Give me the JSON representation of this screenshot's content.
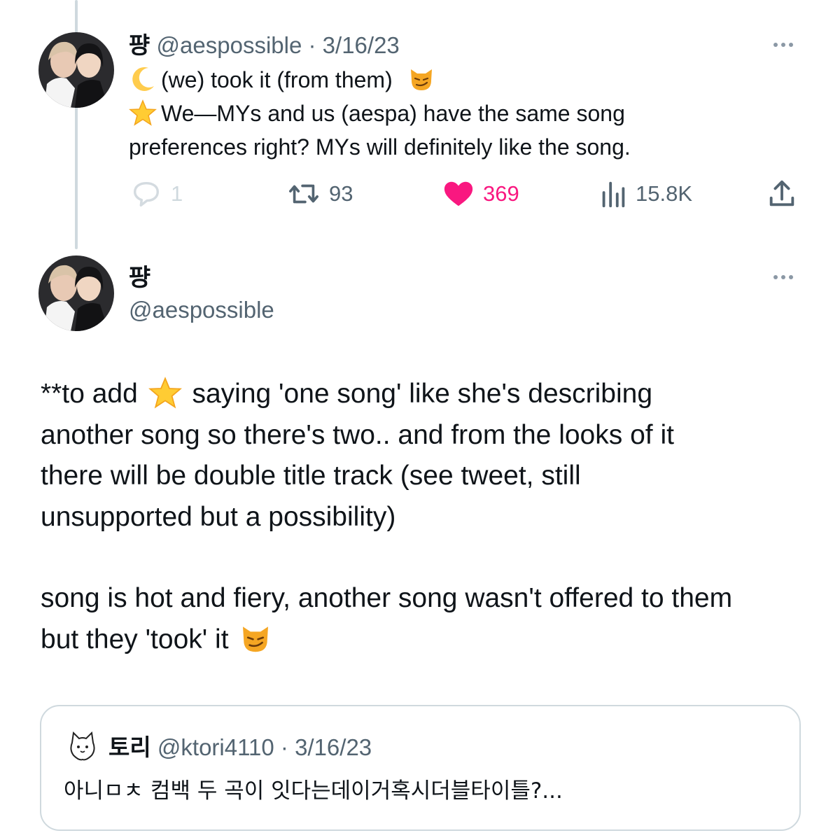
{
  "colors": {
    "text_primary": "#0f1419",
    "text_secondary": "#536471",
    "like_pink": "#f91880",
    "border": "#cfd9de",
    "star_yellow": "#ffcc33",
    "cat_orange": "#f5a623"
  },
  "reply_tweet": {
    "author_name": "퍙",
    "handle": "@aespossible",
    "separator": "·",
    "date": "3/16/23",
    "avatar_icon": "profile-photo",
    "lines": [
      {
        "icon": "crescent-moon-emoji",
        "text": "(we) took it (from them)",
        "trailing_icon": "smirking-cat-emoji"
      },
      {
        "icon": "star-emoji",
        "text": "We—MYs and us (aespa) have the same song"
      },
      {
        "icon": "",
        "text": "preferences right? MYs will definitely like the song."
      }
    ],
    "actions": {
      "reply": {
        "icon": "reply-icon",
        "count": "1"
      },
      "retweet": {
        "icon": "retweet-icon",
        "count": "93"
      },
      "like": {
        "icon": "heart-icon",
        "count": "369",
        "liked": true
      },
      "views": {
        "icon": "views-icon",
        "count": "15.8K"
      },
      "share": {
        "icon": "share-icon"
      }
    }
  },
  "main_tweet": {
    "author_name": "퍙",
    "handle": "@aespossible",
    "avatar_icon": "profile-photo",
    "paragraph1_lines": [
      {
        "before": "**to add",
        "icon": "star-emoji",
        "after": "saying 'one song' like she's describing"
      },
      {
        "text": "another song so there's two.. and from the looks of it"
      },
      {
        "text": "there will be double title track (see tweet, still"
      },
      {
        "text": "unsupported but a possibility)"
      }
    ],
    "paragraph2_lines": [
      {
        "text": "song is hot and fiery, another song wasn't offered to them"
      },
      {
        "text": "but they 'took' it",
        "icon": "smirking-cat-emoji"
      }
    ]
  },
  "quoted_tweet": {
    "avatar_icon": "cat-avatar-icon",
    "author_name": "토리",
    "handle": "@ktori4110",
    "separator": "·",
    "date": "3/16/23",
    "text": "아니ㅁㅊ 컴백 두 곡이 잇다는데이거혹시더블타이틀?..."
  }
}
